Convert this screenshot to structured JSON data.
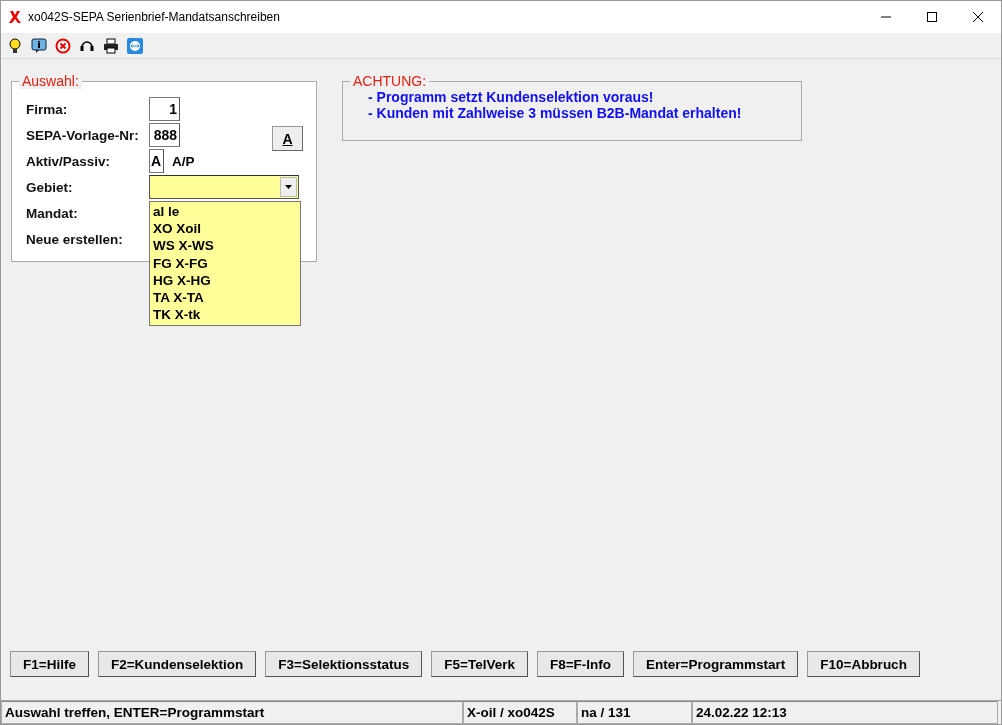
{
  "window": {
    "title": "xo042S-SEPA Serienbrief-Mandatsanschreiben"
  },
  "form": {
    "title": "Auswahl:",
    "side_button": "A",
    "fields": [
      {
        "kind": "number",
        "label": "Firma:",
        "value": "1"
      },
      {
        "kind": "number",
        "label": "SEPA-Vorlage-Nr:",
        "value": "888"
      },
      {
        "kind": "flag",
        "label": "Aktiv/Passiv:",
        "value": "A",
        "hint": "A/P"
      },
      {
        "kind": "combo",
        "label": "Gebiet:",
        "expanded": true,
        "options": [
          "al le",
          "XO Xoil",
          "WS X-WS",
          "FG X-FG",
          "HG X-HG",
          "TA X-TA",
          "TK X-tk"
        ]
      },
      {
        "kind": "covered",
        "label": "Mandat:"
      },
      {
        "kind": "covered",
        "label": "Neue erstellen:"
      }
    ]
  },
  "notice": {
    "title": "ACHTUNG:",
    "lines": [
      "- Programm setzt Kundenselektion voraus!",
      "- Kunden mit Zahlweise 3 müssen B2B-Mandat erhalten!"
    ]
  },
  "buttons": [
    "F1=Hilfe",
    "F2=Kundenselektion",
    "F3=Selektionsstatus",
    "F5=TelVerk",
    "F8=F-Info",
    "Enter=Programmstart",
    "F10=Abbruch"
  ],
  "status_bar": [
    "Auswahl treffen, ENTER=Programmstart",
    "X-oil / xo042S",
    "na / 131",
    "24.02.22 12:13"
  ]
}
